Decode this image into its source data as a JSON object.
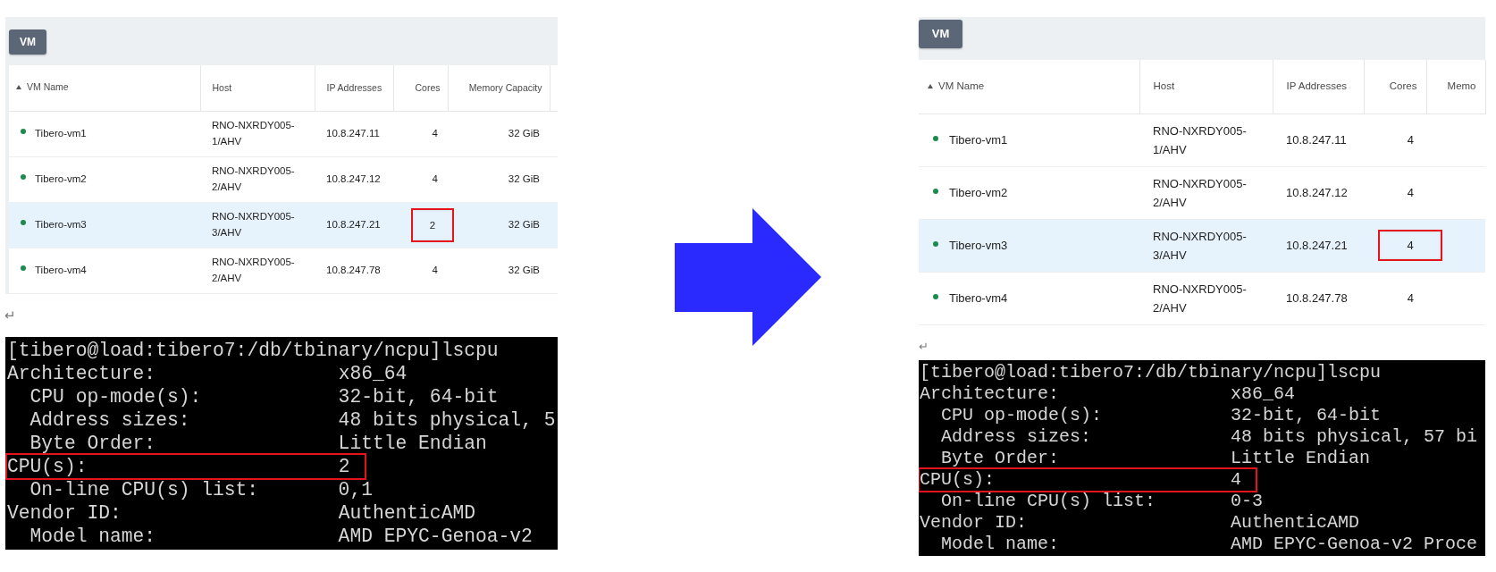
{
  "panels": [
    {
      "toolbar": {
        "button": "VM"
      },
      "table": {
        "columns": [
          {
            "label": "VM Name",
            "sorted": true
          },
          {
            "label": "Host",
            "sorted": false
          },
          {
            "label": "IP Addresses",
            "sorted": false
          },
          {
            "label": "Cores",
            "sorted": false
          },
          {
            "label": "Memory Capacity",
            "sorted": false
          }
        ],
        "rows": [
          {
            "selected": false,
            "color": "#1f8a4f",
            "cells": [
              {
                "text": "Tibero-vm1",
                "marked": false
              },
              {
                "text": "RNO-NXRDY005-1/AHV",
                "marked": false
              },
              {
                "text": "10.8.247.11",
                "marked": false
              },
              {
                "text": "4",
                "marked": false
              },
              {
                "text": "32 GiB",
                "marked": false
              }
            ]
          },
          {
            "selected": false,
            "color": "#1f8a4f",
            "cells": [
              {
                "text": "Tibero-vm2",
                "marked": false
              },
              {
                "text": "RNO-NXRDY005-2/AHV",
                "marked": false
              },
              {
                "text": "10.8.247.12",
                "marked": false
              },
              {
                "text": "4",
                "marked": false
              },
              {
                "text": "32 GiB",
                "marked": false
              }
            ]
          },
          {
            "selected": true,
            "color": "#1f8a4f",
            "cells": [
              {
                "text": "Tibero-vm3",
                "marked": false
              },
              {
                "text": "RNO-NXRDY005-3/AHV",
                "marked": false
              },
              {
                "text": "10.8.247.21",
                "marked": false
              },
              {
                "text": "2",
                "marked": true
              },
              {
                "text": "32 GiB",
                "marked": false
              }
            ]
          },
          {
            "selected": false,
            "color": "#1f8a4f",
            "cells": [
              {
                "text": "Tibero-vm4",
                "marked": false
              },
              {
                "text": "RNO-NXRDY005-2/AHV",
                "marked": false
              },
              {
                "text": "10.8.247.78",
                "marked": false
              },
              {
                "text": "4",
                "marked": false
              },
              {
                "text": "32 GiB",
                "marked": false
              }
            ]
          }
        ]
      },
      "paragraph_mark": "↵",
      "terminal": {
        "command": "[tibero@load:tibero7:/db/tbinary/ncpu]lscpu",
        "lines": [
          {
            "label": "Architecture:",
            "value": "x86_64",
            "marked": false,
            "children": [
              {
                "label": "CPU op-mode(s):",
                "value": "32-bit, 64-bit",
                "marked": false
              },
              {
                "label": "Address sizes:",
                "value": "48 bits physical, 5",
                "marked": false
              },
              {
                "label": "Byte Order:",
                "value": "Little Endian",
                "marked": false
              }
            ]
          },
          {
            "label": "CPU(s):",
            "value": "2",
            "marked": true,
            "children": [
              {
                "label": "On-line CPU(s) list:",
                "value": "0,1",
                "marked": false
              }
            ]
          },
          {
            "label": "Vendor ID:",
            "value": "AuthenticAMD",
            "marked": false,
            "children": [
              {
                "label": "Model name:",
                "value": "AMD EPYC-Genoa-v2",
                "marked": false
              }
            ]
          }
        ]
      }
    },
    {
      "toolbar": {
        "button": "VM"
      },
      "table": {
        "columns": [
          {
            "label": "VM Name",
            "sorted": true
          },
          {
            "label": "Host",
            "sorted": false
          },
          {
            "label": "IP Addresses",
            "sorted": false
          },
          {
            "label": "Cores",
            "sorted": false
          },
          {
            "label": "Memo",
            "sorted": false
          }
        ],
        "rows": [
          {
            "selected": false,
            "color": "#1f8a4f",
            "cells": [
              {
                "text": "Tibero-vm1",
                "marked": false
              },
              {
                "text": "RNO-NXRDY005-1/AHV",
                "marked": false
              },
              {
                "text": "10.8.247.11",
                "marked": false
              },
              {
                "text": "4",
                "marked": false
              }
            ]
          },
          {
            "selected": false,
            "color": "#1f8a4f",
            "cells": [
              {
                "text": "Tibero-vm2",
                "marked": false
              },
              {
                "text": "RNO-NXRDY005-2/AHV",
                "marked": false
              },
              {
                "text": "10.8.247.12",
                "marked": false
              },
              {
                "text": "4",
                "marked": false
              }
            ]
          },
          {
            "selected": true,
            "color": "#1f8a4f",
            "cells": [
              {
                "text": "Tibero-vm3",
                "marked": false
              },
              {
                "text": "RNO-NXRDY005-3/AHV",
                "marked": false
              },
              {
                "text": "10.8.247.21",
                "marked": false
              },
              {
                "text": "4",
                "marked": true
              }
            ]
          },
          {
            "selected": false,
            "color": "#1f8a4f",
            "cells": [
              {
                "text": "Tibero-vm4",
                "marked": false
              },
              {
                "text": "RNO-NXRDY005-2/AHV",
                "marked": false
              },
              {
                "text": "10.8.247.78",
                "marked": false
              },
              {
                "text": "4",
                "marked": false
              }
            ]
          }
        ]
      },
      "paragraph_mark": "↵",
      "terminal": {
        "command": "[tibero@load:tibero7:/db/tbinary/ncpu]lscpu",
        "lines": [
          {
            "label": "Architecture:",
            "value": "x86_64",
            "marked": false,
            "children": [
              {
                "label": "CPU op-mode(s):",
                "value": "32-bit, 64-bit",
                "marked": false
              },
              {
                "label": "Address sizes:",
                "value": "48 bits physical, 57 bi",
                "marked": false
              },
              {
                "label": "Byte Order:",
                "value": "Little Endian",
                "marked": false
              }
            ]
          },
          {
            "label": "CPU(s):",
            "value": "4",
            "marked": true,
            "children": [
              {
                "label": "On-line CPU(s) list:",
                "value": "0-3",
                "marked": false
              }
            ]
          },
          {
            "label": "Vendor ID:",
            "value": "AuthenticAMD",
            "marked": false,
            "children": [
              {
                "label": "Model name:",
                "value": "AMD EPYC-Genoa-v2 Proce",
                "marked": false
              }
            ]
          }
        ]
      }
    }
  ]
}
